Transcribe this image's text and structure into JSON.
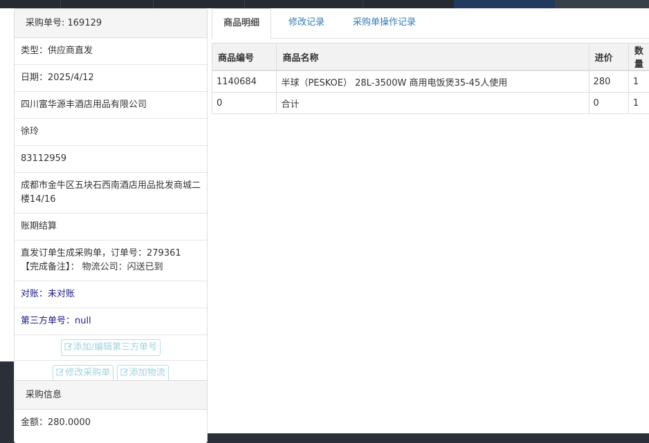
{
  "order_panel": {
    "header": "采购单号: 169129",
    "rows": [
      "类型：供应商直发",
      "日期：2025/4/12",
      "四川富华源丰酒店用品有限公司",
      "徐玲",
      "83112959",
      "成都市金牛区五块石西南酒店用品批发商城二楼14/16",
      "账期结算",
      "直发订单生成采购单，订单号：279361 【完成备注】： 物流公司：闪送已到",
      "对账：未对账",
      "第三方单号：null"
    ],
    "btn_third_party": "添加/编辑第三方单号",
    "btn_edit_order": "修改采购单",
    "btn_add_logistics": "添加物流"
  },
  "purchase_panel": {
    "header": "采购信息",
    "amount": "金额：280.0000"
  },
  "tabs": [
    "商品明细",
    "修改记录",
    "采购单操作记录"
  ],
  "table": {
    "columns": [
      "商品编号",
      "商品名称",
      "进价",
      "数量"
    ],
    "rows": [
      [
        "1140684",
        "半球（PESKOE） 28L-3500W 商用电饭煲35-45人使用",
        "280",
        "1"
      ],
      [
        "0",
        "合计",
        "0",
        "1"
      ]
    ]
  },
  "colors": {
    "link": "#337ab7",
    "reconcile_text": "#1a1a8c",
    "button_border": "#aee0e8",
    "button_text": "#9fd3dd"
  },
  "icons": [
    "edit-icon"
  ]
}
